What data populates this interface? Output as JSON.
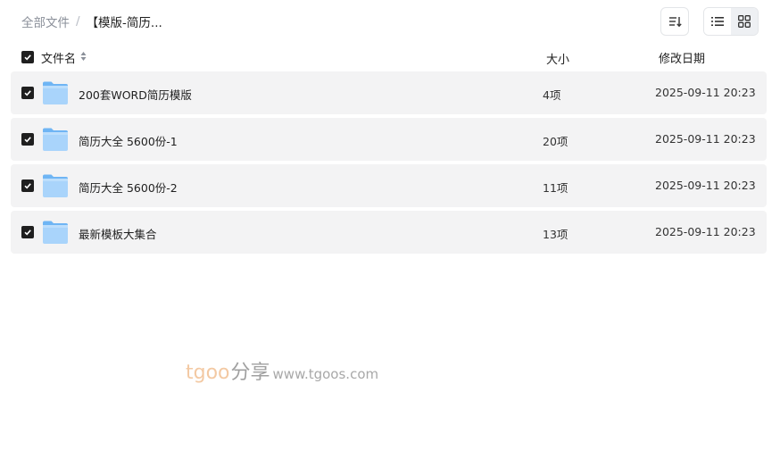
{
  "breadcrumb": {
    "root": "全部文件",
    "separator": "/",
    "current": "【模版-简历..."
  },
  "toolbar": {
    "sort_icon": "sort-list-icon",
    "list_view_icon": "list-view-icon",
    "grid_view_icon": "grid-view-icon"
  },
  "table": {
    "headers": {
      "name": "文件名",
      "size": "大小",
      "modified": "修改日期"
    },
    "rows": [
      {
        "name": "200套WORD简历模版",
        "size": "4项",
        "modified": "2025-09-11 20:23"
      },
      {
        "name": "简历大全 5600份-1",
        "size": "20项",
        "modified": "2025-09-11 20:23"
      },
      {
        "name": "简历大全 5600份-2",
        "size": "11项",
        "modified": "2025-09-11 20:23"
      },
      {
        "name": "最新模板大集合",
        "size": "13项",
        "modified": "2025-09-11 20:23"
      }
    ]
  },
  "watermark": {
    "brand": "tgoo",
    "cn": "分享",
    "url": "www.tgoos.com"
  },
  "colors": {
    "row_bg": "#f3f3f4",
    "checkbox": "#1f1f1f",
    "folder_light": "#a9d4fb",
    "folder_dark": "#6fb5f4"
  }
}
